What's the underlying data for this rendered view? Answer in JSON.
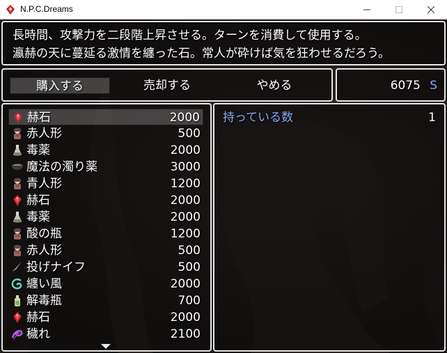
{
  "window": {
    "title": "N.P.C.Dreams",
    "icon": "game-app-icon"
  },
  "help": {
    "line1": "長時間、攻撃力を二段階上昇させる。ターンを消費して使用する。",
    "line2": "瀛赫の天に蔓延る激情を纏った石。常人が砕けば気を狂わせるだろう。"
  },
  "commands": [
    {
      "label": "購入する",
      "selected": true
    },
    {
      "label": "売却する",
      "selected": false
    },
    {
      "label": "やめる",
      "selected": false
    }
  ],
  "gold": {
    "amount": "6075",
    "unit": "S"
  },
  "items": [
    {
      "name": "赫石",
      "price": "2000",
      "icon": "red-gem-icon",
      "selected": true
    },
    {
      "name": "赤人形",
      "price": "500",
      "icon": "doll-icon",
      "selected": false
    },
    {
      "name": "毒薬",
      "price": "2000",
      "icon": "flask-icon",
      "selected": false
    },
    {
      "name": "魔法の濁り薬",
      "price": "3000",
      "icon": "cauldron-icon",
      "selected": false
    },
    {
      "name": "青人形",
      "price": "1200",
      "icon": "doll-icon",
      "selected": false
    },
    {
      "name": "赫石",
      "price": "2000",
      "icon": "red-gem-icon",
      "selected": false
    },
    {
      "name": "毒薬",
      "price": "2000",
      "icon": "flask-icon",
      "selected": false
    },
    {
      "name": "酸の瓶",
      "price": "1200",
      "icon": "doll-icon",
      "selected": false
    },
    {
      "name": "赤人形",
      "price": "500",
      "icon": "doll-icon",
      "selected": false
    },
    {
      "name": "投げナイフ",
      "price": "500",
      "icon": "knife-icon",
      "selected": false
    },
    {
      "name": "纏い風",
      "price": "2000",
      "icon": "wind-icon",
      "selected": false
    },
    {
      "name": "解毒瓶",
      "price": "700",
      "icon": "bottle-icon",
      "selected": false
    },
    {
      "name": "赫石",
      "price": "2000",
      "icon": "red-gem-icon",
      "selected": false
    },
    {
      "name": "穢れ",
      "price": "2100",
      "icon": "purple-swirl-icon",
      "selected": false
    }
  ],
  "status": {
    "label": "持っている数",
    "value": "1"
  },
  "colors": {
    "system_blue": "#84a9f5",
    "panel_border": "#e8e8e8",
    "text": "#ffffff"
  }
}
